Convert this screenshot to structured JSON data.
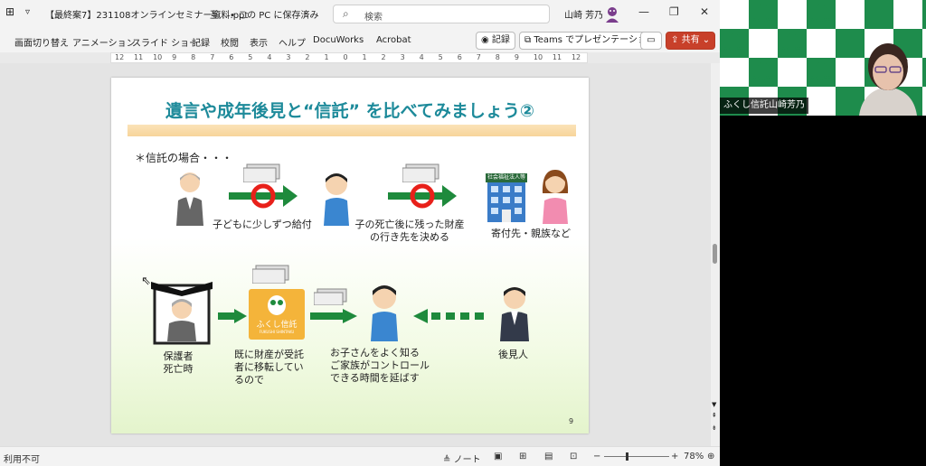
{
  "titlebar": {
    "filename": "【最終案7】231108オンラインセミナー資料.ppt",
    "compat": "互…",
    "save_status": "• この PC に保存済み",
    "search_placeholder": "検索",
    "user": "山崎 芳乃"
  },
  "ribbon": {
    "tabs": [
      "画面切り替え",
      "アニメーション",
      "スライド ショー",
      "記録",
      "校閲",
      "表示",
      "ヘルプ",
      "DocuWorks",
      "Acrobat"
    ],
    "record_label": "記録",
    "teams_label": "Teams でプレゼンテーション",
    "share_label": "共有"
  },
  "ruler": {
    "ticks": [
      "12",
      "11",
      "10",
      "9",
      "8",
      "7",
      "6",
      "5",
      "4",
      "3",
      "2",
      "1",
      "0",
      "1",
      "2",
      "3",
      "4",
      "5",
      "6",
      "7",
      "8",
      "9",
      "10",
      "11",
      "12"
    ]
  },
  "slide": {
    "title": "遺言や成年後見と“信託” を比べてみましょう②",
    "heading": "＊信託の場合・・・",
    "caption_child_gift": "子どもに少しずつ給付",
    "caption_after_death_line1": "子の死亡後に残った財産",
    "caption_after_death_line2": "の行き先を決める",
    "caption_donation": "寄付先・親族など",
    "org_sign": "社会福祉法人等",
    "guardian_line1": "保護者",
    "guardian_line2": "死亡時",
    "transfer_line1": "既に財産が受託",
    "transfer_line2": "者に移転してい",
    "transfer_line3": "るので",
    "control_line1": "お子さんをよく知る",
    "control_line2": "ご家族がコントロール",
    "control_line3": "できる時間を延ばす",
    "guardian_role": "後見人",
    "logo_text": "ふくし信託",
    "logo_sub": "FUKUSHI SHINTAKU",
    "page_number": "9"
  },
  "status": {
    "left": "利用不可",
    "notes": "ノート",
    "zoom": "78%"
  },
  "video": {
    "participant": "ふくし信託山崎芳乃",
    "tile_text": "ふくし信託"
  },
  "colors": {
    "title": "#1d8a9a",
    "arrow": "#1e8a3c",
    "no_circle": "#e8201a",
    "share": "#c8402a",
    "video_green": "#1e8c4c"
  }
}
